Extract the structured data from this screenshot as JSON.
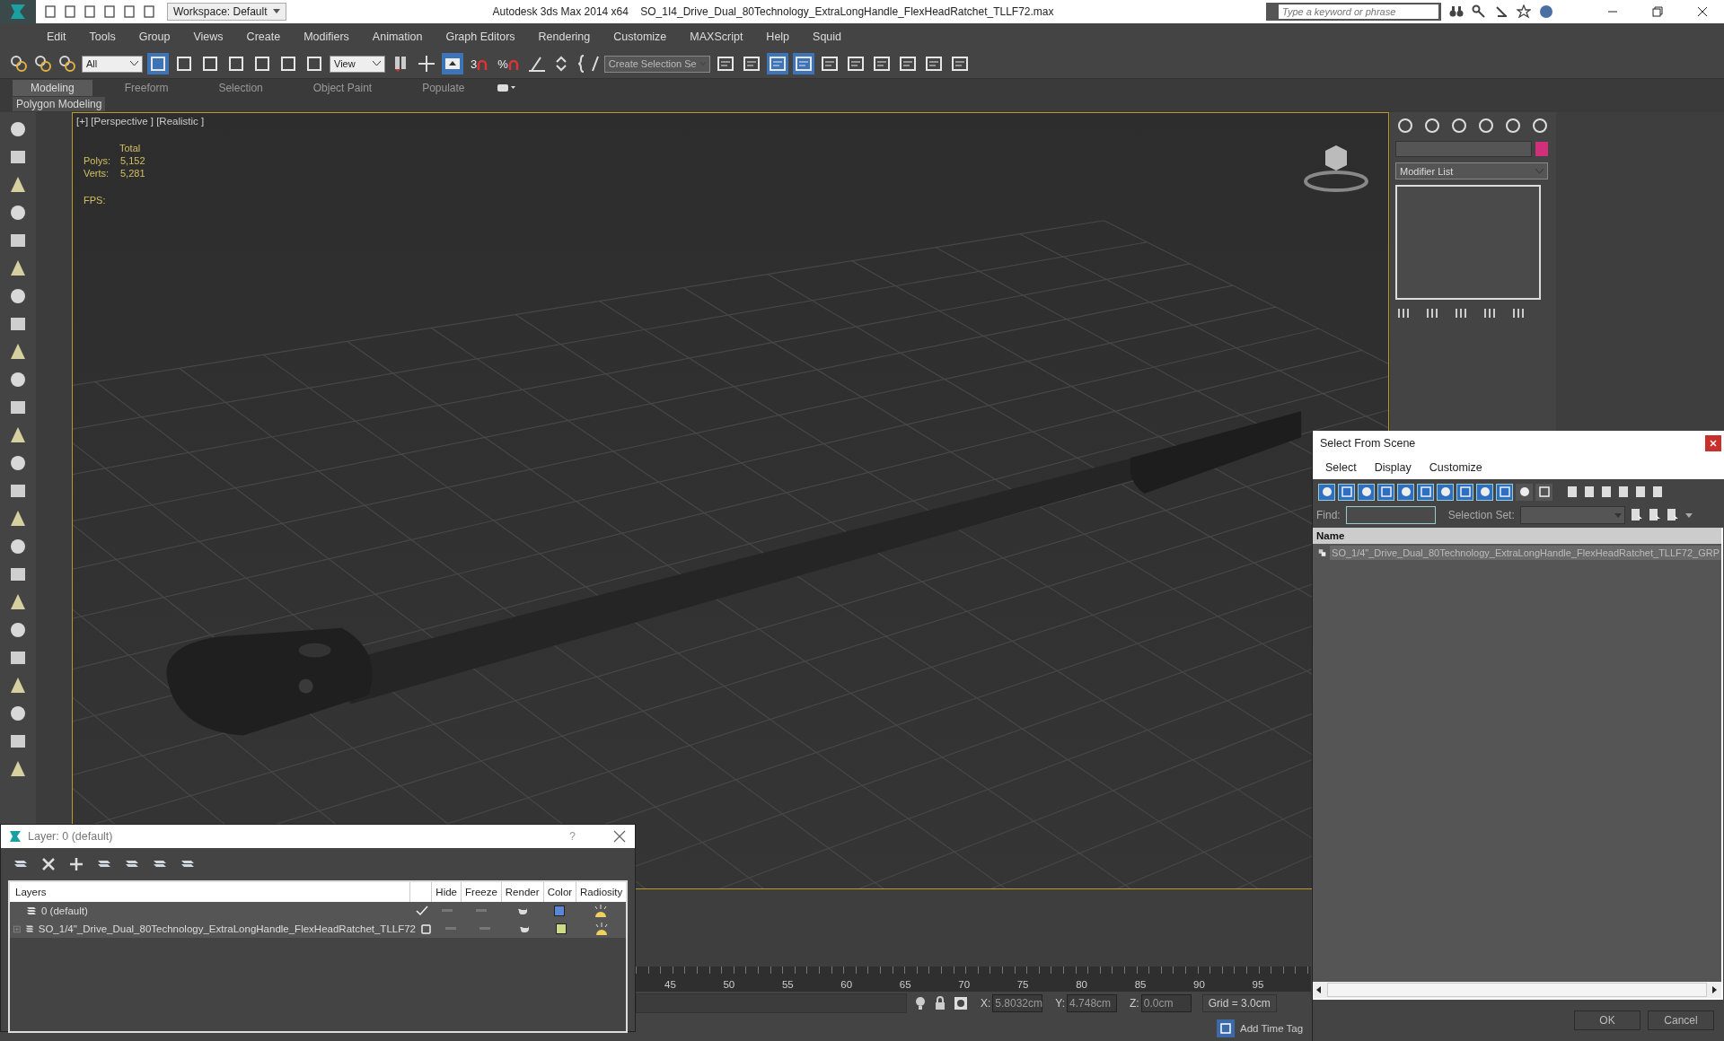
{
  "title_bar": {
    "workspace": "Workspace: Default",
    "app_title": "Autodesk 3ds Max  2014 x64",
    "file_name": "SO_1I4_Drive_Dual_80Technology_ExtraLongHandle_FlexHeadRatchet_TLLF72.max",
    "search": {
      "placeholder": "Type a keyword or phrase"
    }
  },
  "menu": [
    "Edit",
    "Tools",
    "Group",
    "Views",
    "Create",
    "Modifiers",
    "Animation",
    "Graph Editors",
    "Rendering",
    "Customize",
    "MAXScript",
    "Help",
    "Squid"
  ],
  "toolbar": {
    "selection_filter": "All",
    "coordinate_system": "View",
    "snaps": [
      {
        "glyph": "3"
      },
      {
        "glyph": "%"
      }
    ],
    "named_selection": "Create Selection Se"
  },
  "ribbon": {
    "tabs": [
      {
        "label": "Modeling",
        "selected": true
      },
      {
        "label": "Freeform",
        "selected": false
      },
      {
        "label": "Selection",
        "selected": false
      },
      {
        "label": "Object Paint",
        "selected": false
      },
      {
        "label": "Populate",
        "selected": false
      }
    ],
    "panel_label": "Polygon Modeling"
  },
  "viewport": {
    "label": "[+] [Perspective ] [Realistic ]",
    "stats_heading": "Total",
    "stats": [
      {
        "label": "Polys:",
        "value": "5,152"
      },
      {
        "label": "Verts:",
        "value": "5,281"
      }
    ],
    "fps_label": "FPS:"
  },
  "command_panel": {
    "modifier_list": "Modifier List",
    "color": "#d0307a"
  },
  "timeline": {
    "ticks": [
      "45",
      "50",
      "55",
      "60",
      "65",
      "70",
      "75",
      "80",
      "85",
      "90",
      "95"
    ]
  },
  "status_bar": {
    "coords": [
      {
        "label": "X:",
        "value": "5.8032cm"
      },
      {
        "label": "Y:",
        "value": "4.748cm"
      },
      {
        "label": "Z:",
        "value": "0.0cm"
      }
    ],
    "grid": "Grid = 3.0cm",
    "time_tag": "Add Time Tag"
  },
  "layer_dialog": {
    "title": "Layer: 0 (default)",
    "help": "?",
    "columns": [
      "Layers",
      "Hide",
      "Freeze",
      "Render",
      "Color",
      "Radiosity"
    ],
    "rows": [
      {
        "name": "0 (default)",
        "current": true,
        "expandable": false,
        "color": "#5b86d6"
      },
      {
        "name": "SO_1/4\"_Drive_Dual_80Technology_ExtraLongHandle_FlexHeadRatchet_TLLF72",
        "current": false,
        "expandable": true,
        "color": "#cfd98a"
      }
    ]
  },
  "scene_dialog": {
    "title": "Select From Scene",
    "menu": [
      "Select",
      "Display",
      "Customize"
    ],
    "filters": [
      {
        "on": true
      },
      {
        "on": true
      },
      {
        "on": true
      },
      {
        "on": true
      },
      {
        "on": true
      },
      {
        "on": true
      },
      {
        "on": true
      },
      {
        "on": true
      },
      {
        "on": true
      },
      {
        "on": true
      },
      {
        "on": false
      },
      {
        "on": false
      }
    ],
    "find_label": "Find:",
    "selection_set_label": "Selection Set:",
    "column": "Name",
    "items": [
      {
        "name": "SO_1/4\"_Drive_Dual_80Technology_ExtraLongHandle_FlexHeadRatchet_TLLF72_GRP",
        "selected": true
      }
    ],
    "buttons": [
      "OK",
      "Cancel"
    ]
  }
}
